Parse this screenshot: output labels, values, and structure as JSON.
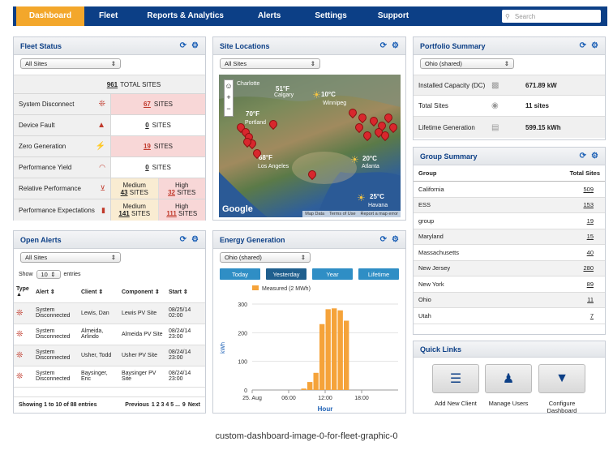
{
  "nav": {
    "tabs": [
      "Dashboard",
      "Fleet",
      "Reports & Analytics",
      "Alerts",
      "Settings",
      "Support"
    ],
    "search_placeholder": "Search"
  },
  "fleet": {
    "title": "Fleet Status",
    "select": "All Sites",
    "total_num": "961",
    "total_label": "TOTAL SITES",
    "rows": [
      {
        "label": "System Disconnect",
        "num": "67",
        "unit": "SITES"
      },
      {
        "label": "Device Fault",
        "num": "0",
        "unit": "SITES"
      },
      {
        "label": "Zero Generation",
        "num": "19",
        "unit": "SITES"
      },
      {
        "label": "Performance Yield",
        "num": "0",
        "unit": "SITES"
      }
    ],
    "rel": {
      "label": "Relative Performance",
      "a_lbl": "Medium",
      "a_num": "43",
      "a_unit": "SITES",
      "b_lbl": "High",
      "b_num": "32",
      "b_unit": "SITES"
    },
    "exp": {
      "label": "Performance Expectations",
      "a_lbl": "Medium",
      "a_num": "141",
      "a_unit": "SITES",
      "b_lbl": "High",
      "b_num": "111",
      "b_unit": "SITES"
    }
  },
  "map": {
    "title": "Site Locations",
    "select": "All Sites",
    "labels": {
      "charlotte": "Charlotte",
      "calgary": "Calgary",
      "winnipeg": "Winnipeg",
      "portland": "Portland",
      "la": "Los Angeles",
      "atlanta": "Atlanta",
      "havana": "Havana"
    },
    "temps": {
      "t1": "51°F",
      "t2": "10°C",
      "t3": "70°F",
      "t4": "68°F",
      "t5": "20°C",
      "t6": "25°C"
    },
    "footer": [
      "Map Data",
      "Terms of Use",
      "Report a map error"
    ],
    "google": "Google"
  },
  "portfolio": {
    "title": "Portfolio Summary",
    "select": "Ohio (shared)",
    "rows": [
      {
        "label": "Installed Capacity (DC)",
        "value": "671.89 kW"
      },
      {
        "label": "Total Sites",
        "value": "11 sites"
      },
      {
        "label": "Lifetime Generation",
        "value": "599.15 kWh"
      }
    ]
  },
  "group": {
    "title": "Group Summary",
    "col1": "Group",
    "col2": "Total Sites",
    "rows": [
      [
        "California",
        "509"
      ],
      [
        "ESS",
        "153"
      ],
      [
        "group",
        "19"
      ],
      [
        "Maryland",
        "15"
      ],
      [
        "Massachusetts",
        "40"
      ],
      [
        "New Jersey",
        "280"
      ],
      [
        "New York",
        "89"
      ],
      [
        "Ohio",
        "11"
      ],
      [
        "Utah",
        "7"
      ]
    ]
  },
  "alerts": {
    "title": "Open Alerts",
    "select": "All Sites",
    "show": "Show",
    "entries_val": "10",
    "entries": "entries",
    "cols": [
      "Type",
      "Alert",
      "Client",
      "Component",
      "Start"
    ],
    "rows": [
      {
        "alert": "System Disconnected",
        "client": "Lewis, Dan",
        "component": "Lewis PV Site",
        "start": "08/25/14 02:00"
      },
      {
        "alert": "System Disconnected",
        "client": "Almeida, Arlindo",
        "component": "Almeida PV Site",
        "start": "08/24/14 23:00"
      },
      {
        "alert": "System Disconnected",
        "client": "Usher, Todd",
        "component": "Usher PV Site",
        "start": "08/24/14 23:00"
      },
      {
        "alert": "System Disconnected",
        "client": "Baysinger, Eric",
        "component": "Baysinger PV Site",
        "start": "08/24/14 23:00"
      }
    ],
    "showing": "Showing 1 to 10 of 88 entries",
    "prev": "Previous",
    "pages": "1 2 3 4 5 ...",
    "last": "9",
    "next": "Next"
  },
  "energy": {
    "title": "Energy Generation",
    "select": "Ohio (shared)",
    "buttons": [
      "Today",
      "Yesterday",
      "Year",
      "Lifetime"
    ]
  },
  "chart_data": {
    "type": "bar",
    "title": "",
    "xlabel": "Hour",
    "ylabel": "kWh",
    "ylim": [
      0,
      300
    ],
    "yticks": [
      0,
      100,
      200,
      300
    ],
    "xticks": [
      "25. Aug",
      "06:00",
      "12:00",
      "18:00"
    ],
    "series": [
      {
        "name": "Measured (2 MWh)",
        "color": "#f5a33a",
        "hours": [
          8,
          9,
          10,
          11,
          12,
          13,
          14,
          15
        ],
        "values": [
          5,
          28,
          60,
          230,
          282,
          285,
          278,
          242
        ]
      }
    ],
    "legend": "top-left"
  },
  "quick": {
    "title": "Quick Links",
    "items": [
      "Add New Client",
      "Manage Users",
      "Configure Dashboard"
    ]
  },
  "caption": "custom-dashboard-image-0-for-fleet-graphic-0",
  "colors": {
    "nav": "#0c3f86",
    "active": "#f3a72b",
    "bar": "#f5a33a",
    "button": "#2f8ec5"
  }
}
